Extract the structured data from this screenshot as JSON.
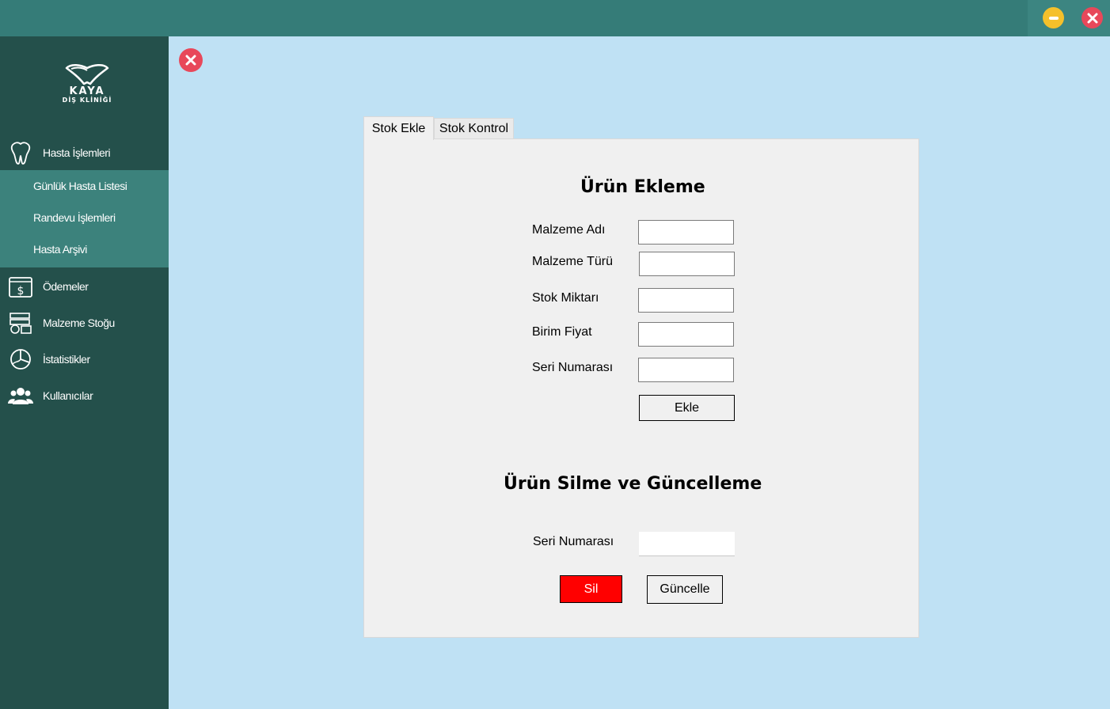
{
  "window": {
    "minimize_icon": "minimize-icon",
    "close_icon": "close-icon",
    "colors": {
      "titlebar": "#357c78",
      "minimize": "#f5c02b",
      "close": "#e8485a"
    }
  },
  "sidebar": {
    "logo": {
      "name": "KAYA",
      "subtitle": "DİŞ KLİNİĞİ"
    },
    "items": [
      {
        "label": "Hasta İşlemleri",
        "icon": "tooth-icon"
      },
      {
        "label": "Ödemeler",
        "icon": "payment-icon"
      },
      {
        "label": "Malzeme Stoğu",
        "icon": "inventory-icon"
      },
      {
        "label": "İstatistikler",
        "icon": "chart-icon"
      },
      {
        "label": "Kullanıcılar",
        "icon": "users-icon"
      }
    ],
    "submenu": [
      {
        "label": "Günlük Hasta Listesi"
      },
      {
        "label": "Randevu İşlemleri"
      },
      {
        "label": "Hasta Arşivi"
      }
    ],
    "colors": {
      "background": "#24504b",
      "submenu": "#3c827c"
    }
  },
  "tabs": [
    {
      "label": "Stok Ekle",
      "active": true
    },
    {
      "label": "Stok Kontrol",
      "active": false
    }
  ],
  "add_section": {
    "title": "Ürün Ekleme",
    "fields": [
      {
        "label": "Malzeme Adı",
        "value": ""
      },
      {
        "label": "Malzeme Türü",
        "value": ""
      },
      {
        "label": "Stok Miktarı",
        "value": ""
      },
      {
        "label": "Birim Fiyat",
        "value": ""
      },
      {
        "label": "Seri Numarası",
        "value": ""
      }
    ],
    "add_button": "Ekle"
  },
  "edit_section": {
    "title": "Ürün Silme ve Güncelleme",
    "serial_label": "Seri Numarası",
    "serial_value": "",
    "delete_button": "Sil",
    "update_button": "Güncelle",
    "colors": {
      "delete": "#ff0000"
    }
  }
}
